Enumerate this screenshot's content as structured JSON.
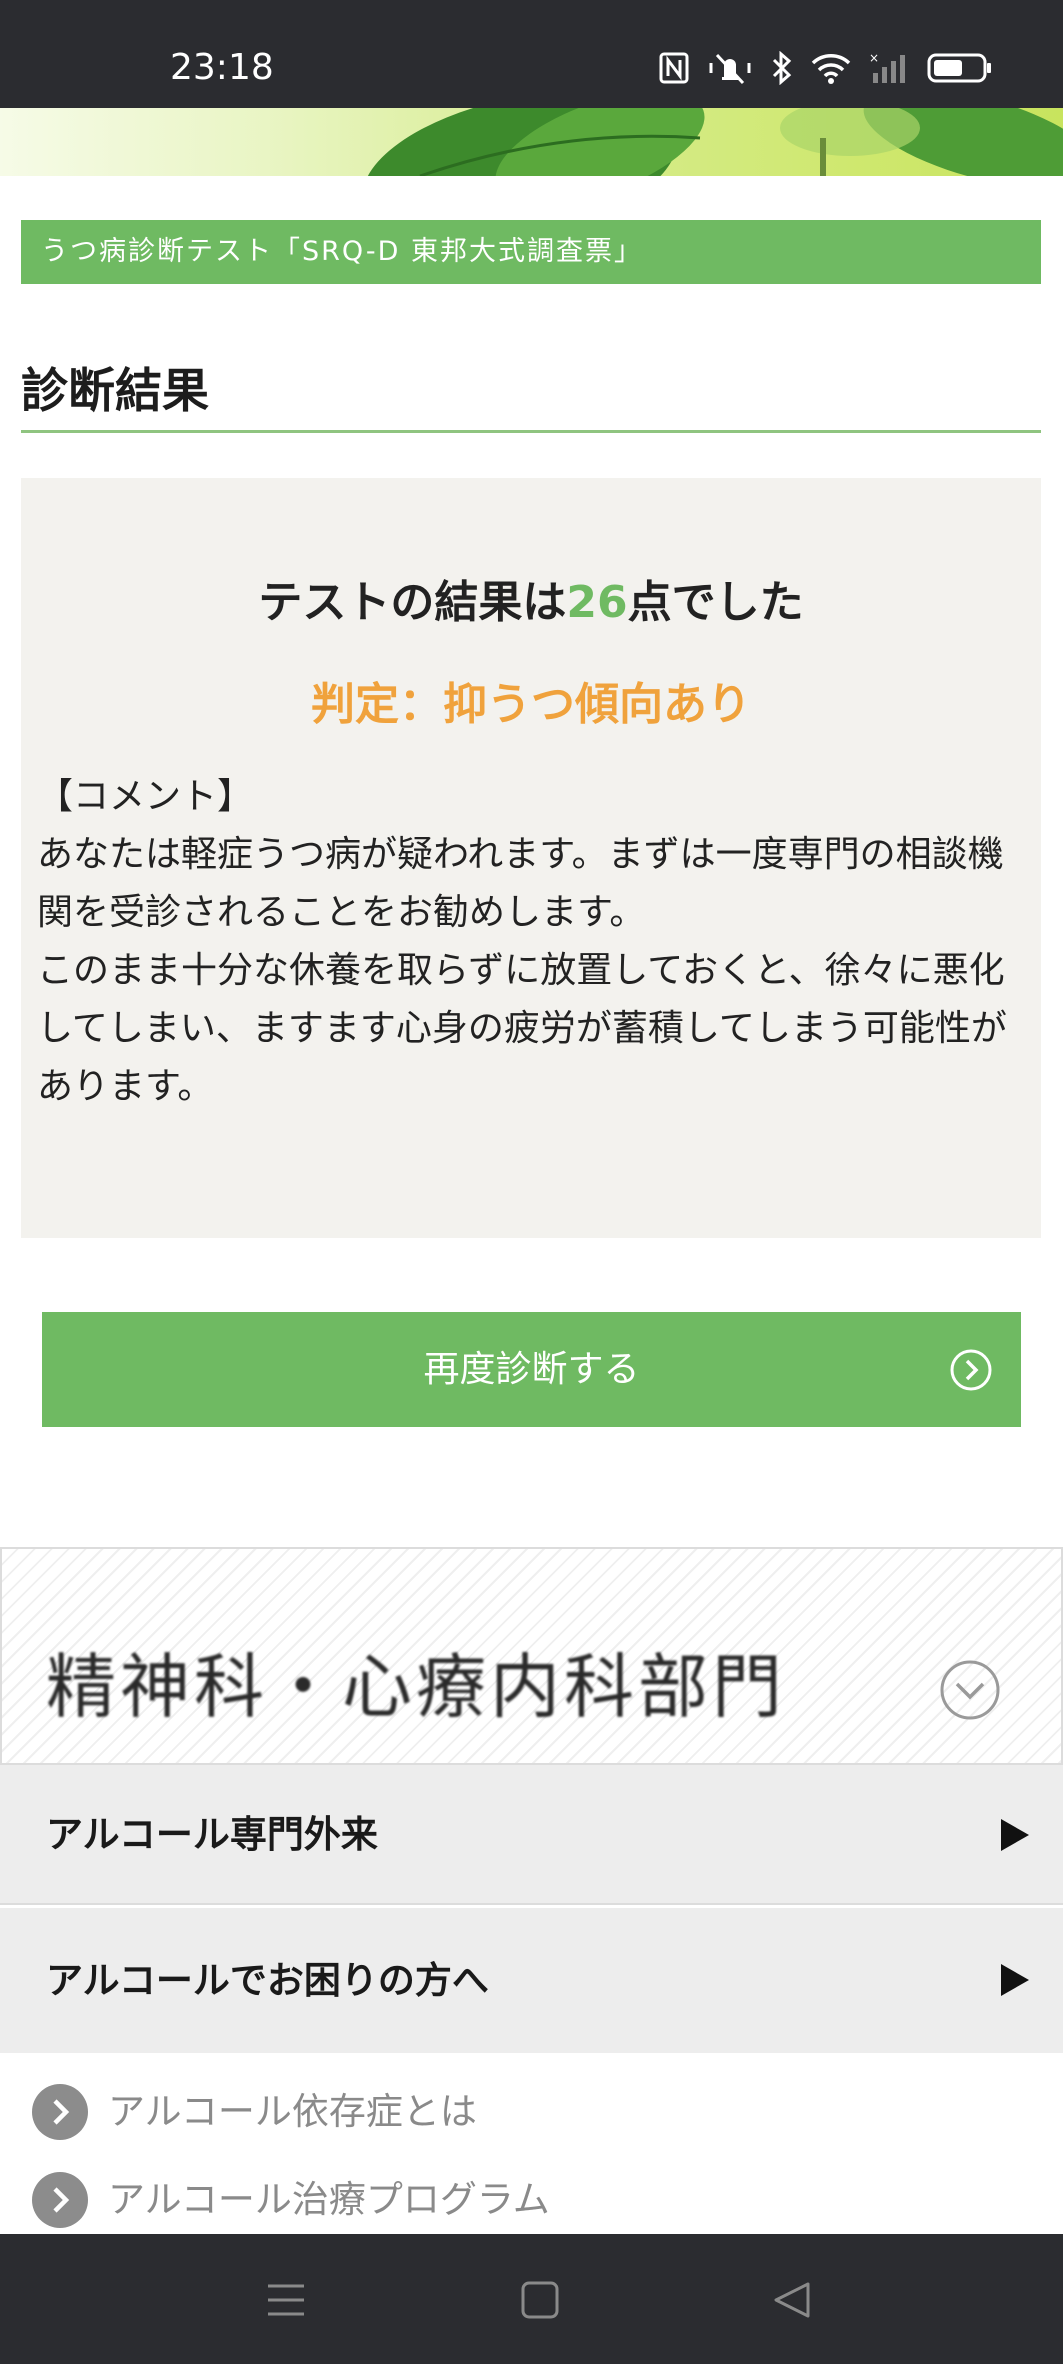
{
  "status_bar": {
    "time": "23:18",
    "icons": [
      "nfc-icon",
      "mute-vibrate-icon",
      "bluetooth-icon",
      "wifi-icon",
      "signal-icon",
      "battery-icon"
    ]
  },
  "page": {
    "title_bar": "うつ病診断テスト「SRQ-D 東邦大式調査票」",
    "heading": "診断結果"
  },
  "result": {
    "score_prefix": "テストの結果は",
    "score": "26",
    "score_suffix": "点でした",
    "verdict": "判定：抑うつ傾向あり",
    "comment_label": "【コメント】",
    "comment_1": "あなたは軽症うつ病が疑われます。まずは一度専門の相談機関を受診されることをお勧めします。",
    "comment_2": "このまま十分な休養を取らずに放置しておくと、徐々に悪化してしまい、ますます心身の疲労が蓄積してしまう可能性があります。"
  },
  "actions": {
    "retry_label": "再度診断する"
  },
  "department": {
    "title": "精神科・心療内科部門",
    "menu": [
      {
        "label": "アルコール専門外来"
      },
      {
        "label": "アルコールでお困りの方へ"
      }
    ],
    "sub_items": [
      {
        "label": "アルコール依存症とは"
      },
      {
        "label": "アルコール治療プログラム"
      }
    ]
  },
  "colors": {
    "accent_green": "#6fba62",
    "verdict_orange": "#f0a23c",
    "system_bar": "#2b2c30"
  }
}
